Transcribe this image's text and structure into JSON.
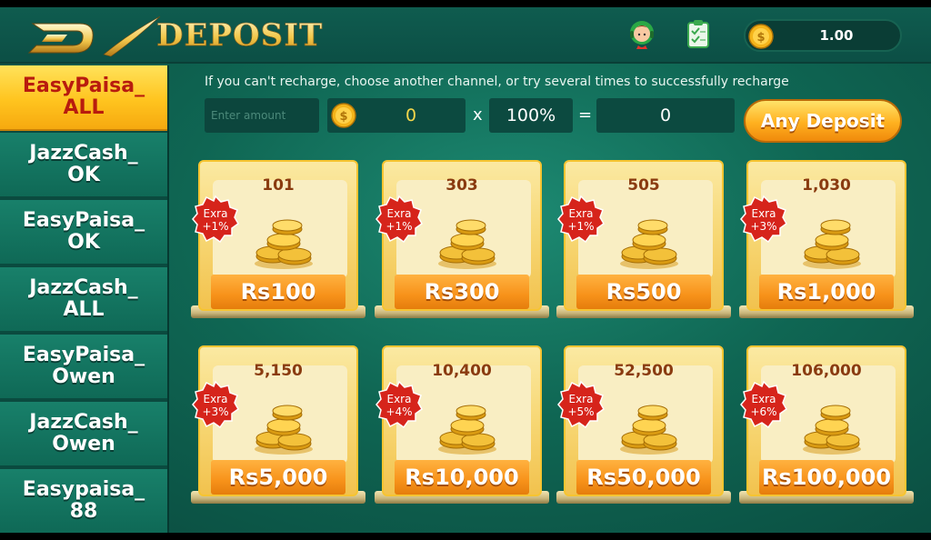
{
  "header": {
    "title": "DEPOSIT",
    "balance": "1.00"
  },
  "sidebar": {
    "items": [
      {
        "label": "EasyPaisa_\nALL",
        "active": true
      },
      {
        "label": "JazzCash_\nOK",
        "active": false
      },
      {
        "label": "EasyPaisa_\nOK",
        "active": false
      },
      {
        "label": "JazzCash_\nALL",
        "active": false
      },
      {
        "label": "EasyPaisa_\nOwen",
        "active": false
      },
      {
        "label": "JazzCash_\nOwen",
        "active": false
      },
      {
        "label": "Easypaisa_\n88",
        "active": false
      }
    ]
  },
  "main": {
    "notice": "If you can't recharge, choose another channel, or try several times to successfully recharge",
    "amount_placeholder": "Enter amount",
    "coin_value": "0",
    "multiply": "x",
    "percent": "100%",
    "equals": "=",
    "total": "0",
    "any_deposit_label": "Any Deposit"
  },
  "cards": [
    {
      "qty": "101",
      "bonus": "Exra\n+1%",
      "price": "Rs100"
    },
    {
      "qty": "303",
      "bonus": "Exra\n+1%",
      "price": "Rs300"
    },
    {
      "qty": "505",
      "bonus": "Exra\n+1%",
      "price": "Rs500"
    },
    {
      "qty": "1,030",
      "bonus": "Exra\n+3%",
      "price": "Rs1,000"
    },
    {
      "qty": "5,150",
      "bonus": "Exra\n+3%",
      "price": "Rs5,000"
    },
    {
      "qty": "10,400",
      "bonus": "Exra\n+4%",
      "price": "Rs10,000"
    },
    {
      "qty": "52,500",
      "bonus": "Exra\n+5%",
      "price": "Rs50,000"
    },
    {
      "qty": "106,000",
      "bonus": "Exra\n+6%",
      "price": "Rs100,000"
    }
  ],
  "colors": {
    "background": "#0f6653",
    "accent": "#ffc41f",
    "active_text": "#b81b0e",
    "price_orange": "#f7921a",
    "badge_red": "#d6241b"
  },
  "icons": [
    "logo-icon",
    "support-icon",
    "history-icon",
    "coin-icon",
    "coins-stack-icon",
    "bonus-badge-icon"
  ]
}
